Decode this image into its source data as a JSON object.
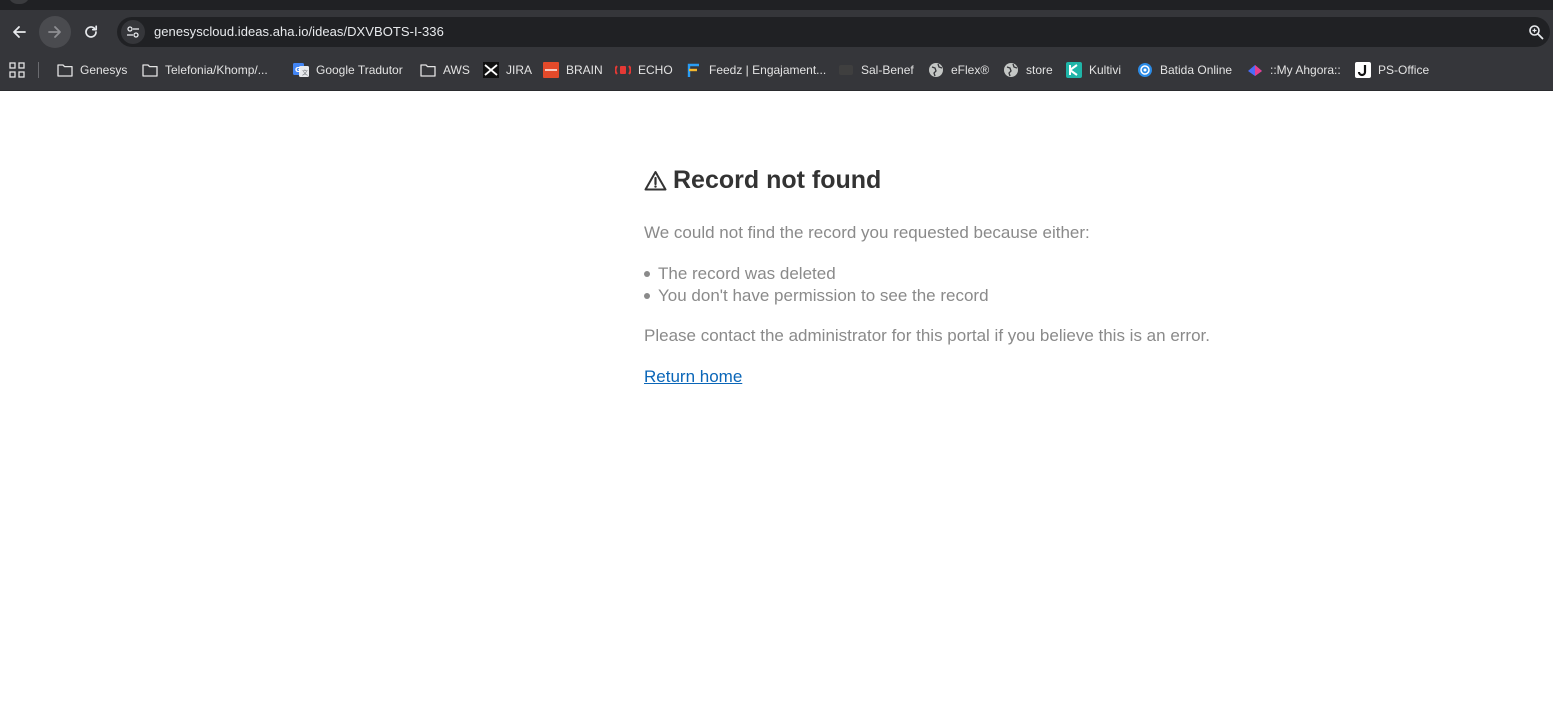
{
  "browser": {
    "url": "genesyscloud.ideas.aha.io/ideas/DXVBOTS-I-336",
    "bookmarks": [
      {
        "label": "Genesys",
        "icon": "folder-icon"
      },
      {
        "label": "Telefonia/Khomp/...",
        "icon": "folder-icon"
      },
      {
        "label": "Google Tradutor",
        "icon": "google-translate-icon"
      },
      {
        "label": "AWS",
        "icon": "folder-icon"
      },
      {
        "label": "JIRA",
        "icon": "jira-icon"
      },
      {
        "label": "BRAIN",
        "icon": "brain-icon"
      },
      {
        "label": "ECHO",
        "icon": "echo-icon"
      },
      {
        "label": "Feedz | Engajament...",
        "icon": "feedz-icon"
      },
      {
        "label": "Sal-Benef",
        "icon": "sal-benef-icon"
      },
      {
        "label": "eFlex®",
        "icon": "globe-icon"
      },
      {
        "label": "store",
        "icon": "globe-icon"
      },
      {
        "label": "Kultivi",
        "icon": "kultivi-icon"
      },
      {
        "label": "Batida Online",
        "icon": "batida-icon"
      },
      {
        "label": "::My Ahgora::",
        "icon": "ahgora-icon"
      },
      {
        "label": "PS-Office",
        "icon": "ps-office-icon"
      }
    ]
  },
  "page": {
    "title": "Record not found",
    "intro": "We could not find the record you requested because either:",
    "reasons": [
      "The record was deleted",
      "You don't have permission to see the record"
    ],
    "contact": "Please contact the administrator for this portal if you believe this is an error.",
    "return_link": "Return home"
  },
  "colors": {
    "chrome_dark": "#35363a",
    "omnibox": "#202124",
    "heading": "#333333",
    "body_text": "#8a8a8a",
    "link": "#0a66b8"
  }
}
